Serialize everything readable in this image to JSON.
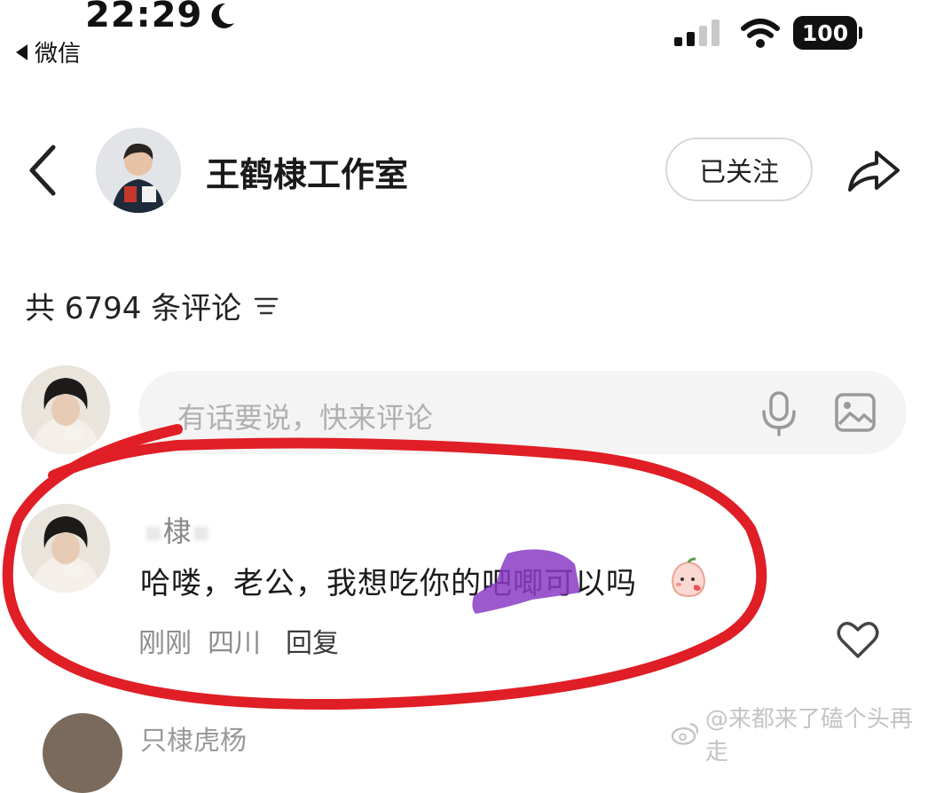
{
  "status_bar": {
    "time": "22:29",
    "back_app": "微信",
    "battery": "100"
  },
  "header": {
    "title": "王鹤棣工作室",
    "follow_label": "已关注"
  },
  "comments": {
    "count_text": "共 6794 条评论"
  },
  "composer": {
    "placeholder": "有话要说，快来评论"
  },
  "comment": {
    "username": "棣",
    "text": "哈喽，老公，我想吃你的吧唧可以吗",
    "time": "刚刚",
    "location": "四川",
    "reply_label": "回复"
  },
  "next_comment": {
    "username": "只棣虎杨"
  },
  "watermark": {
    "text": "@来都来了磕个头再走"
  },
  "colors": {
    "annotation_red": "#e01e25",
    "scribble_purple": "#8a3cc4",
    "muted_text": "#8c8c8c"
  }
}
